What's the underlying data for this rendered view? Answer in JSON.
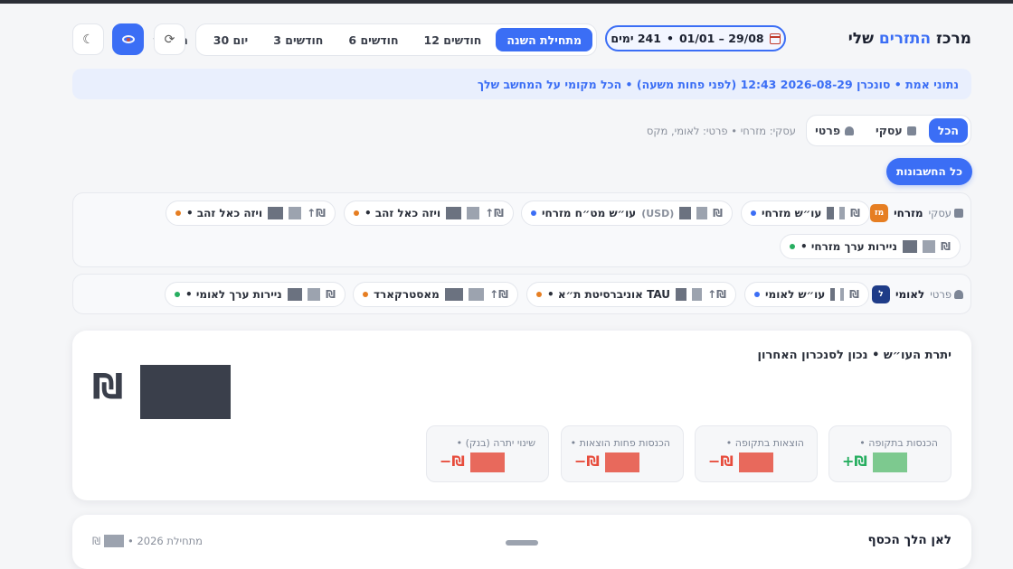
{
  "header": {
    "title_main": "מרכז",
    "title_accent": "התזרים",
    "title_end": "שלי",
    "date_range": "01/01 – 29/08",
    "days": "241 ימים",
    "periods": [
      "מתחילת השנה",
      "12 חודשים",
      "6 חודשים",
      "3 חודשים",
      "30 יום",
      "החודש"
    ],
    "active_period": "מתחילת השנה",
    "refresh_icon": "⟳",
    "theme_icon": "☾"
  },
  "notice": "נתוני אמת • סונכרן 2026-08-29 12:43 (לפני פחות משעה) • הכל מקומי על המחשב שלך",
  "filters": {
    "all": "הכל",
    "business": "עסקי",
    "personal": "פרטי",
    "description": "עסקי: מזרחי • פרטי: לאומי, מקס",
    "all_accounts": "כל החשבונות"
  },
  "groups": [
    {
      "badge": "מז",
      "badge_color": "#e67e22",
      "name": "מזרחי",
      "type": "עסקי",
      "accounts": [
        {
          "name": "עו״ש מזרחי",
          "dot": "#3b6ef5",
          "currency": "₪"
        },
        {
          "name": "עו״ש מט״ח מזרחי",
          "dot": "#3b6ef5",
          "usd": "(USD)",
          "currency": "₪"
        },
        {
          "name": "ויזה כאל זהב •",
          "dot": "#e67e22",
          "currency": "₪↑"
        },
        {
          "name": "ויזה כאל זהב •",
          "dot": "#e67e22",
          "currency": "₪↑"
        },
        {
          "name": "ניירות ערך מזרחי •",
          "dot": "#27ae60",
          "currency": "₪"
        }
      ]
    },
    {
      "badge": "ל",
      "badge_color": "#1f3c88",
      "name": "לאומי",
      "type": "פרטי",
      "accounts": [
        {
          "name": "עו״ש לאומי",
          "dot": "#3b6ef5",
          "currency": "₪"
        },
        {
          "name": "TAU אוניברסיטת ת״א •",
          "dot": "#e67e22",
          "currency": "₪↑"
        },
        {
          "name": "מאסטרקארד",
          "dot": "#e67e22",
          "currency": "₪↑"
        },
        {
          "name": "ניירות ערך לאומי •",
          "dot": "#27ae60",
          "currency": "₪"
        }
      ]
    }
  ],
  "balance": {
    "title": "יתרת העו״ש • נכון לסנכרון האחרון",
    "currency": "₪",
    "stats": [
      {
        "label": "הכנסות בתקופה •",
        "sign": "+₪",
        "color": "#27ae60",
        "mask_color": "#7dc98f"
      },
      {
        "label": "הוצאות בתקופה •",
        "sign": "−₪",
        "color": "#e74c3c",
        "mask_color": "#e8695c"
      },
      {
        "label": "הכנסות פחות הוצאות •",
        "sign": "−₪",
        "color": "#e74c3c",
        "mask_color": "#e8695c"
      },
      {
        "label": "שינוי יתרה (בנק) •",
        "sign": "−₪",
        "color": "#e74c3c",
        "mask_color": "#e8695c"
      }
    ]
  },
  "bottom": {
    "title": "לאן הלך הכסף",
    "meta_start": "מתחילת 2026 •",
    "meta_currency": "₪"
  }
}
